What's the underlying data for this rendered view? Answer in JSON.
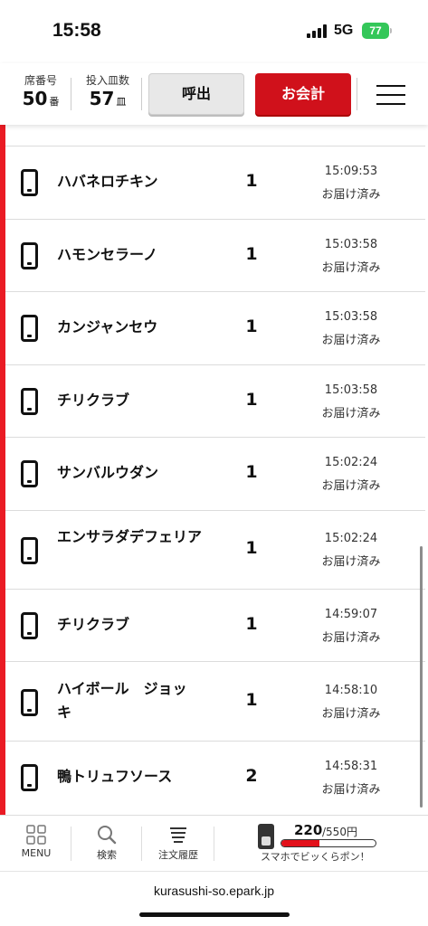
{
  "status_bar": {
    "time": "15:58",
    "network": "5G",
    "battery": "77"
  },
  "header": {
    "seat_label": "席番号",
    "seat_number": "50",
    "seat_unit": "番",
    "plates_label": "投入皿数",
    "plates_number": "57",
    "plates_unit": "皿",
    "call_button": "呼出",
    "checkout_button": "お会計"
  },
  "orders": [
    {
      "name": "ハバネロチキン",
      "qty": "1",
      "time": "15:09:53",
      "status": "お届け済み"
    },
    {
      "name": "ハモンセラーノ",
      "qty": "1",
      "time": "15:03:58",
      "status": "お届け済み"
    },
    {
      "name": "カンジャンセウ",
      "qty": "1",
      "time": "15:03:58",
      "status": "お届け済み"
    },
    {
      "name": "チリクラブ",
      "qty": "1",
      "time": "15:03:58",
      "status": "お届け済み"
    },
    {
      "name": "サンバルウダン",
      "qty": "1",
      "time": "15:02:24",
      "status": "お届け済み"
    },
    {
      "name": "エンサラダデフェリア",
      "qty": "1",
      "time": "15:02:24",
      "status": "お届け済み"
    },
    {
      "name": "チリクラブ",
      "qty": "1",
      "time": "14:59:07",
      "status": "お届け済み"
    },
    {
      "name": "ハイボール　ジョッキ",
      "qty": "1",
      "time": "14:58:10",
      "status": "お届け済み"
    },
    {
      "name": "鴨トリュフソース",
      "qty": "2",
      "time": "14:58:31",
      "status": "お届け済み"
    }
  ],
  "bottom_nav": {
    "menu": "MENU",
    "search": "検索",
    "history": "注文履歴",
    "promo_count": "220",
    "promo_total": "/550円",
    "promo_text": "スマホでビッくらポン！",
    "promo_progress": 0.4
  },
  "url": "kurasushi-so.epark.jp",
  "colors": {
    "accent_red": "#d0111b",
    "side_bar": "#ea1b24",
    "battery_green": "#34c759"
  }
}
